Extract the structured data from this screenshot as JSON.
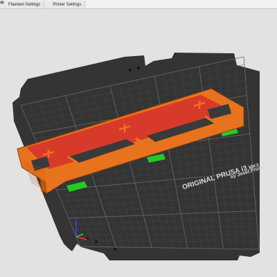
{
  "tabs": [
    {
      "label": "Filament Settings",
      "icon": "spool-icon"
    },
    {
      "label": "Printer Settings",
      "icon": "printer-icon"
    }
  ],
  "bed": {
    "brand_line1": "ORIGINAL PRUSA i3",
    "brand_suffix": "MK3",
    "brand_line2": "by Josef Prusa"
  },
  "colors": {
    "perimeter": "#e8731e",
    "infill": "#d83a2a",
    "support": "#22cc22",
    "bed_surface": "#343434",
    "background": "#e2e2e2"
  }
}
